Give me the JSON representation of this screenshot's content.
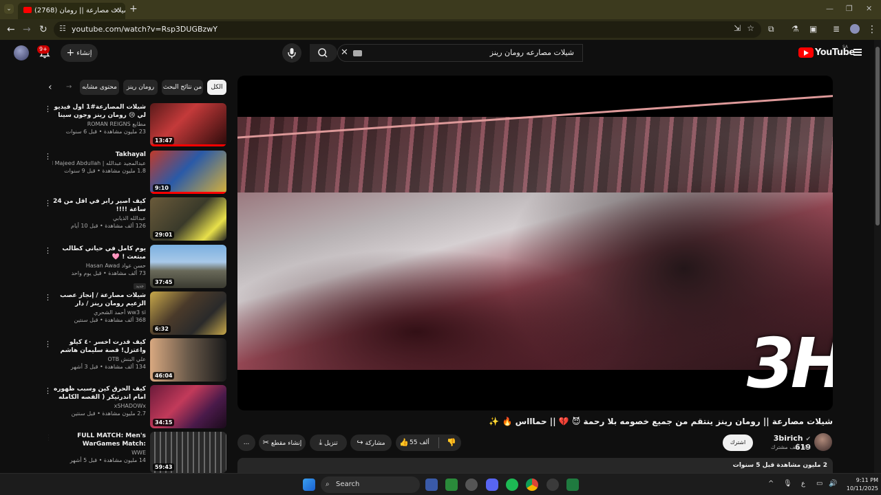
{
  "browser": {
    "tab_title": "(2768) شيلات مصارعة || رومان",
    "url": "youtube.com/watch?v=Rsp3DUGBzwY",
    "new_tab_symbol": "+"
  },
  "header": {
    "search_query": "شيلات مصارعه رومان رينز",
    "create_label": "إنشاء",
    "notification_count": "9+",
    "logo_text": "YouTube",
    "country_code": "SA"
  },
  "chips": [
    "الكل",
    "من نتائج البحث",
    "رومان رينز",
    "محتوى مشابه"
  ],
  "related": [
    {
      "title": "شيلات المصارعة#1 اول فيديو لي 😢 رومان رينز وجون سينا ضد سملوا جو وذا ...",
      "channel": "مطايع ROMAN REIGNS",
      "stats": "23 مليون مشاهدة • قبل 6 سنوات",
      "duration": "13:47",
      "progress": 1.0
    },
    {
      "title": "Takhayal",
      "channel": "عبدالمجيد عبدالله | Abdul Majeed Abdullah",
      "stats": "1.8 مليون مشاهدة • قبل 9 سنوات",
      "duration": "9:10",
      "progress": 1.0
    },
    {
      "title": "كيف اصير رابر في اقل من 24 ساعة !!!!",
      "channel": "عبدالله الذيابي",
      "stats": "126 ألف مشاهدة • قبل 10 أيام",
      "duration": "29:01",
      "progress": 0
    },
    {
      "title": "يوم كامل في حياتي كطالب مبتعث ! 🩷",
      "channel": "حسن عواد Hasan Awad",
      "stats": "73 ألف مشاهدة • قبل يوم واحد",
      "duration": "37:45",
      "badge": "جديد",
      "progress": 0
    },
    {
      "title": "شيلات مصارعة / إنجاز عصب الزعيم رومان رينز / دار يالحبيبي دار 🔥 😎 ...",
      "channel": "ww3 si أحمد الشحري",
      "stats": "368 ألف مشاهدة • قبل سنتين",
      "duration": "6:32",
      "progress": 0
    },
    {
      "title": "كيف قدرت اخسر ٤٠ كيلو واعتزل! قصة سليمان هاشم مع الذي | بودكاست على ...",
      "channel": "علي البنش OTB",
      "stats": "134 ألف مشاهدة • قبل 3 أشهر",
      "duration": "46:04",
      "progress": 0
    },
    {
      "title": "كيف الحرق كين وسبب ظهوره امام اندرتيكر ( القصه الكامله 🔥 💀 )",
      "channel": "xSHADOWx",
      "stats": "2.7 مليون مشاهدة • قبل سنتين",
      "duration": "34:15",
      "progress": 0
    },
    {
      "title": "FULL MATCH: Men's WarGames Match: Survivor Series: ...",
      "channel": "WWE",
      "stats": "14 مليون مشاهدة • قبل 5 أشهر",
      "duration": "59:43",
      "progress": 0
    }
  ],
  "video": {
    "title": "شيلات مصارعة || رومان رينز ينتقم من جميع خصومه بلا رحمة 😈 💔 || حماااس 🔥 ✨",
    "watermark": "3H",
    "channel_name": "3birich 619",
    "subscribers": "141 ألف مشترك",
    "subscribe_label": "اشترك",
    "likes": "55 ألف",
    "share_label": "مشاركة",
    "download_label": "تنزيل",
    "clip_label": "إنشاء مقطع",
    "more_label": "...",
    "view_info": "2 مليون مشاهدة قبل 5 سنوات"
  },
  "taskbar": {
    "search_label": "Search",
    "time": "9:11 PM",
    "date": "10/11/2025",
    "lang": "ع"
  }
}
